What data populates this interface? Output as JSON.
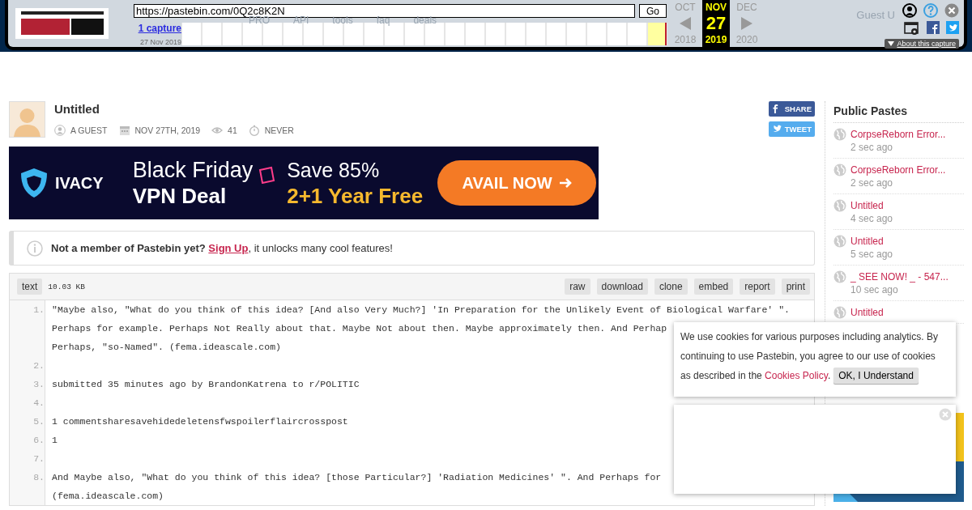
{
  "header": {
    "nav": [
      "PRO",
      "API",
      "tools",
      "faq",
      "deals"
    ],
    "user": "Guest U"
  },
  "wayback": {
    "url": "https://pastebin.com/0Q2c8K2N",
    "go": "Go",
    "captures": "1 capture",
    "capture_date": "27 Nov 2019",
    "about": "About this capture",
    "months": [
      {
        "month": "OCT",
        "year": "2018",
        "selected": false
      },
      {
        "month": "NOV",
        "day": "27",
        "year": "2019",
        "selected": true
      },
      {
        "month": "DEC",
        "year": "2020",
        "selected": false
      }
    ]
  },
  "paste": {
    "title": "Untitled",
    "author": "A GUEST",
    "date": "NOV 27TH, 2019",
    "views": "41",
    "expires": "NEVER"
  },
  "share_buttons": [
    {
      "kind": "facebook",
      "label": "SHARE"
    },
    {
      "kind": "twitter",
      "label": "TWEET"
    }
  ],
  "ad": {
    "brand": "IVACY",
    "headline": "Black Friday",
    "subline": "VPN Deal",
    "offer": "Save 85%",
    "bonus": "2+1 Year Free",
    "cta": "AVAIL NOW"
  },
  "notice": {
    "lead": "Not a member of Pastebin yet?",
    "link": "Sign Up",
    "rest": ", it unlocks many cool features!"
  },
  "code": {
    "syntax": "text",
    "size": "10.03 KB",
    "actions": [
      "raw",
      "download",
      "clone",
      "embed",
      "report",
      "print"
    ],
    "lines": [
      {
        "number": "1.",
        "rows": [
          "\"Maybe also, \"What do you think of this idea? [And also Very Much?] 'In Preparation for the Unlikely Event of Biological Warfare' \".",
          "Perhaps for example. Perhaps Not Really about that. Maybe Not about then. Maybe approximately then. And Perhap",
          "Perhaps, \"so-Named\". (fema.ideascale.com)"
        ]
      },
      {
        "number": "2."
      },
      {
        "number": "3.",
        "rows": [
          "submitted 35 minutes ago by BrandonKatrena to r/POLITIC"
        ]
      },
      {
        "number": "4."
      },
      {
        "number": "5.",
        "rows": [
          "1 commentsharesavehidedeletensfwspoilerflaircrosspost"
        ]
      },
      {
        "number": "6.",
        "rows": [
          "1"
        ]
      },
      {
        "number": "7."
      },
      {
        "number": "8.",
        "rows": [
          "And Maybe also, \"What do you think of this idea? [those Particular?] 'Radiation Medicines' \". And Perhaps for",
          "(fema.ideascale.com)"
        ]
      }
    ]
  },
  "sidebar": {
    "title": "Public Pastes",
    "items": [
      {
        "title": "CorpseReborn Error...",
        "time": "2 sec ago"
      },
      {
        "title": "CorpseReborn Error...",
        "time": "2 sec ago"
      },
      {
        "title": "Untitled",
        "time": "4 sec ago"
      },
      {
        "title": "Untitled",
        "time": "5 sec ago"
      },
      {
        "title": "_ SEE NOW! _ - 547...",
        "time": "10 sec ago"
      },
      {
        "title": "Untitled"
      }
    ]
  },
  "cookie": {
    "text": "We use cookies for various purposes including analytics. By continuing to use Pastebin, you agree to our use of cookies as described in the ",
    "link": "Cookies Policy",
    "after": ".",
    "button": "OK, I Understand"
  }
}
